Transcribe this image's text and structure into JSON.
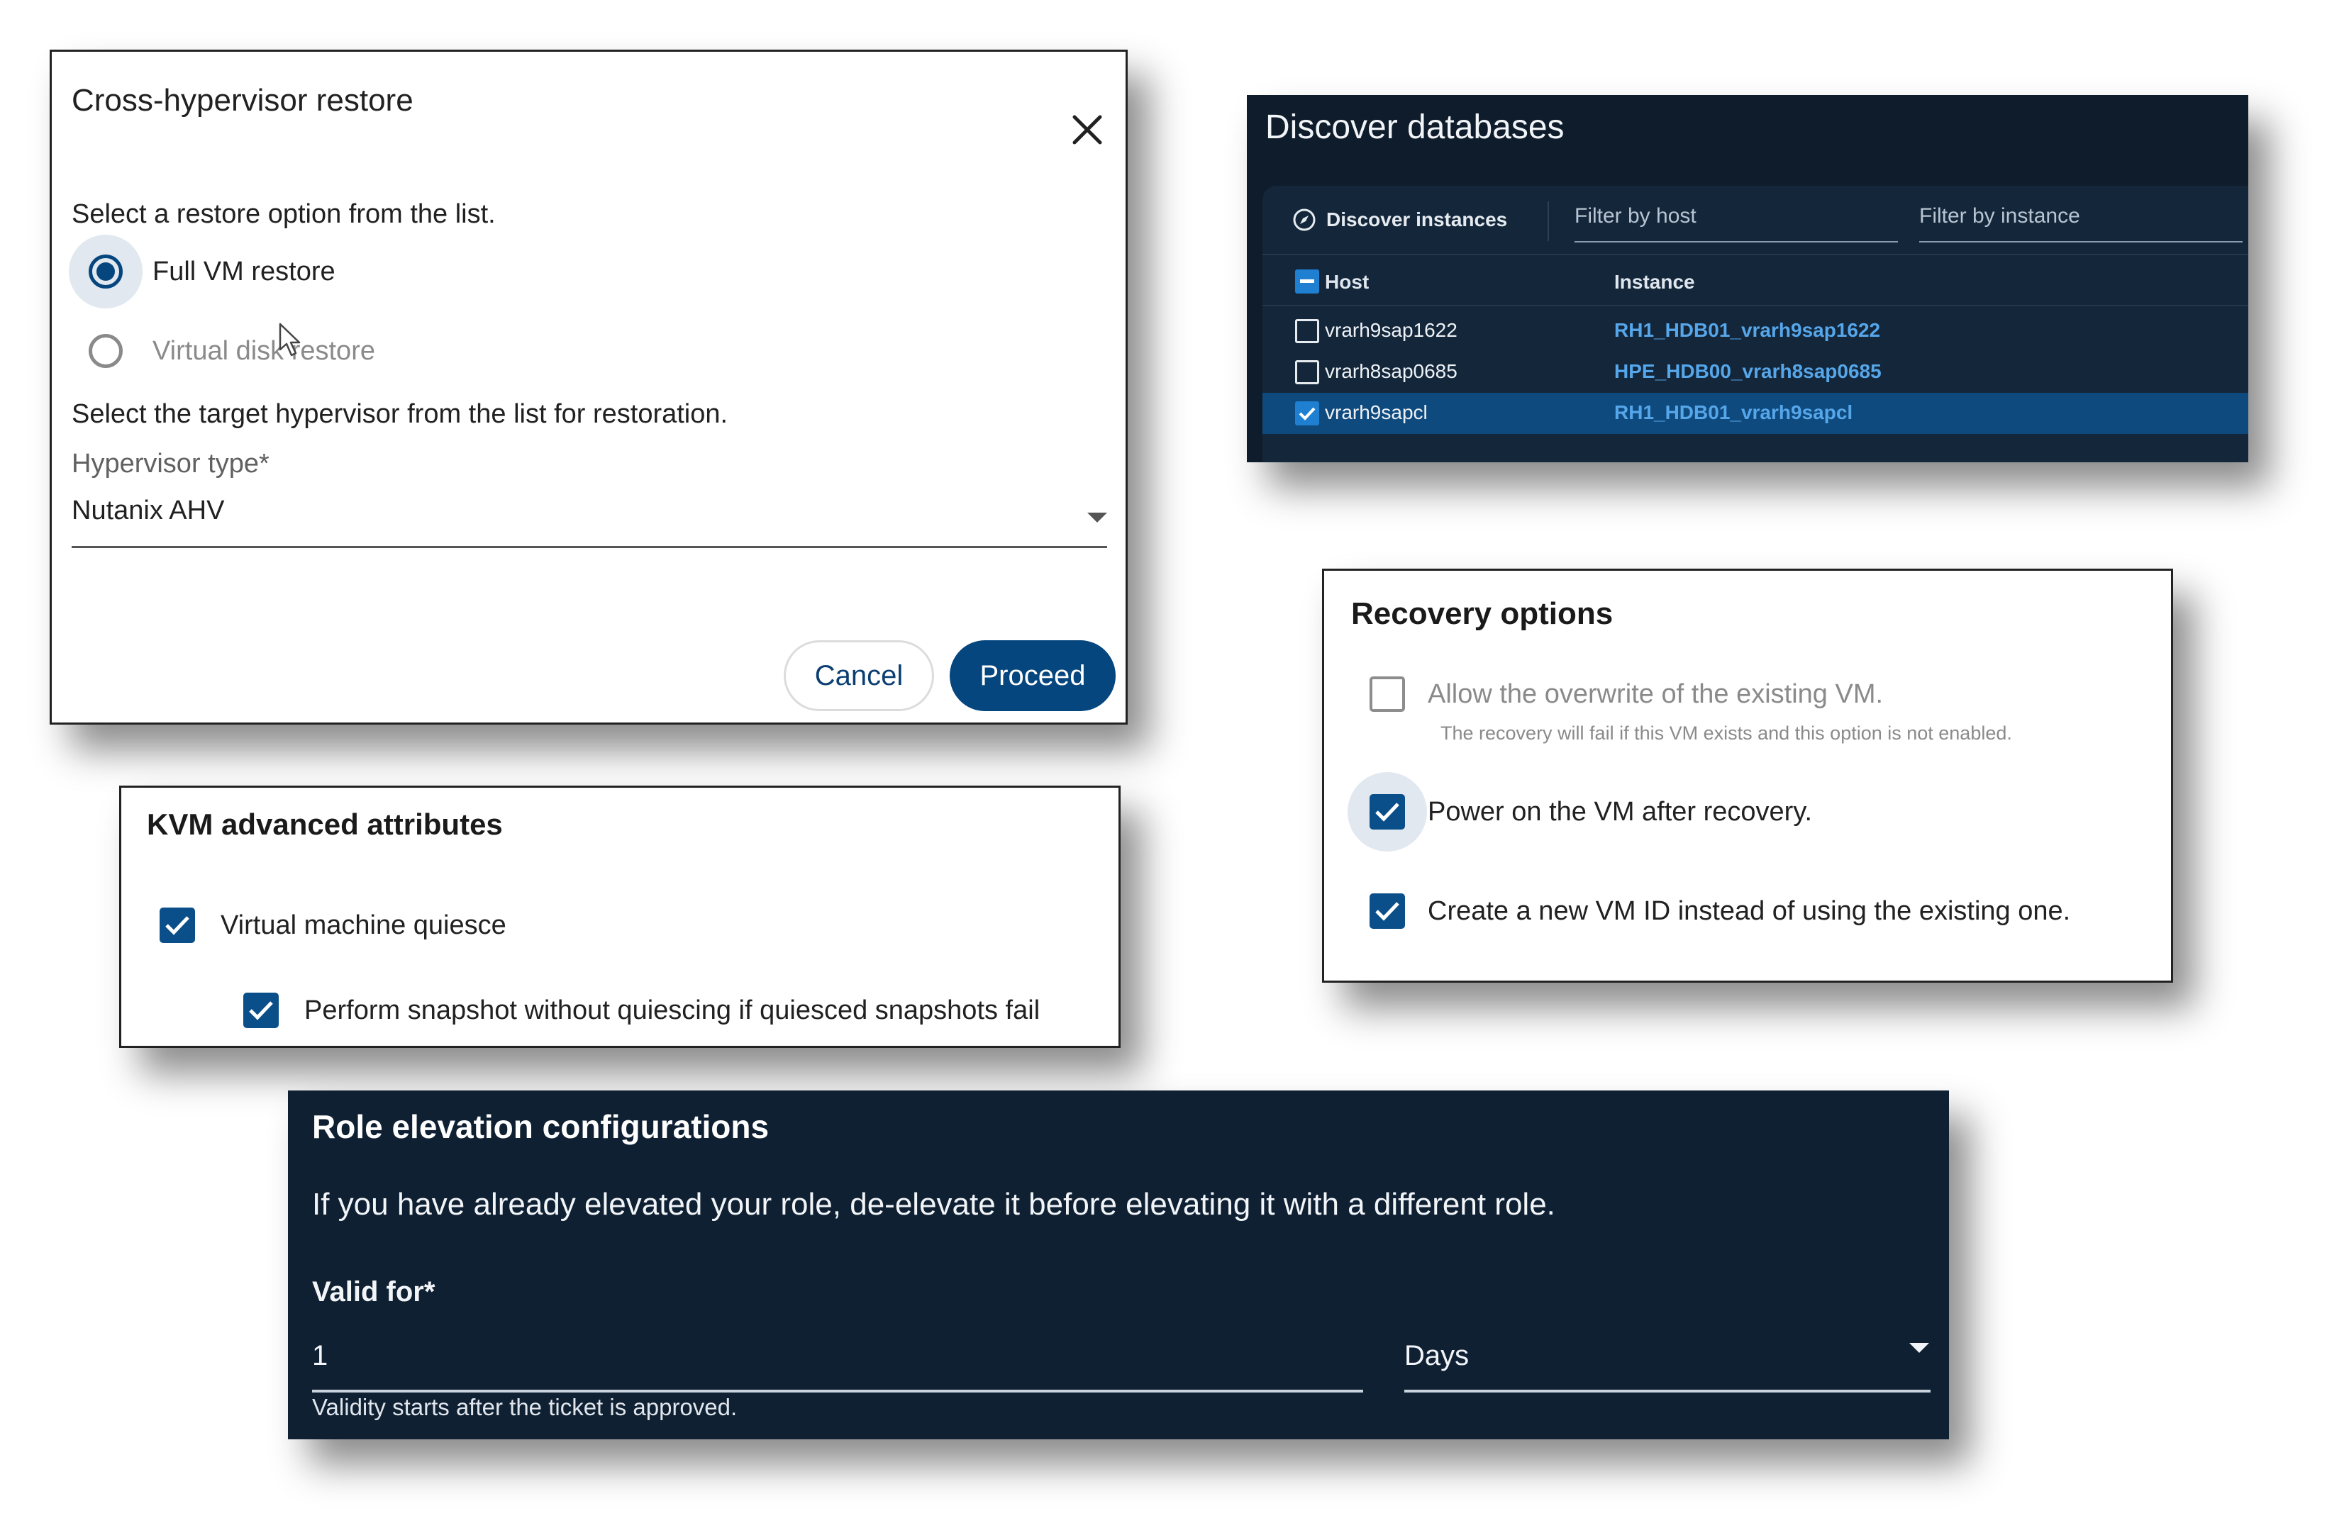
{
  "cross_hypervisor": {
    "title": "Cross-hypervisor restore",
    "prompt": "Select a restore option from the list.",
    "options": [
      {
        "label": "Full VM restore",
        "selected": true
      },
      {
        "label": "Virtual disk restore",
        "selected": false
      }
    ],
    "target_prompt": "Select the target hypervisor from the list for restoration.",
    "hypervisor_label": "Hypervisor type*",
    "hypervisor_value": "Nutanix AHV",
    "cancel_label": "Cancel",
    "proceed_label": "Proceed"
  },
  "discover": {
    "title": "Discover databases",
    "discover_button": "Discover instances",
    "filter_host_placeholder": "Filter by host",
    "filter_instance_placeholder": "Filter by instance",
    "columns": [
      "Host",
      "Instance"
    ],
    "rows": [
      {
        "host": "vrarh9sap1622",
        "instance": "RH1_HDB01_vrarh9sap1622",
        "checked": false
      },
      {
        "host": "vrarh8sap0685",
        "instance": "HPE_HDB00_vrarh8sap0685",
        "checked": false
      },
      {
        "host": "vrarh9sapcl",
        "instance": "RH1_HDB01_vrarh9sapcl",
        "checked": true
      }
    ]
  },
  "kvm": {
    "title": "KVM advanced attributes",
    "options": [
      {
        "label": "Virtual machine quiesce",
        "checked": true
      },
      {
        "label": "Perform snapshot without quiescing if quiesced snapshots fail",
        "checked": true
      }
    ]
  },
  "recovery": {
    "title": "Recovery options",
    "options": [
      {
        "label": "Allow the overwrite of the existing VM.",
        "help": "The recovery will fail if this VM exists and this option is not enabled.",
        "checked": false
      },
      {
        "label": "Power on the VM after recovery.",
        "checked": true
      },
      {
        "label": "Create a new VM ID instead of using the existing one.",
        "checked": true
      }
    ]
  },
  "role": {
    "title": "Role elevation configurations",
    "description": "If you have already elevated your role, de-elevate it before elevating it with a different role.",
    "valid_label": "Valid for*",
    "valid_value": "1",
    "unit_value": "Days",
    "help": "Validity starts after the ticket is approved."
  },
  "colors": {
    "primary": "#06467e",
    "checkbox": "#0b4f8a",
    "dark_bg": "#0f2033",
    "link_blue": "#56a6ea"
  }
}
